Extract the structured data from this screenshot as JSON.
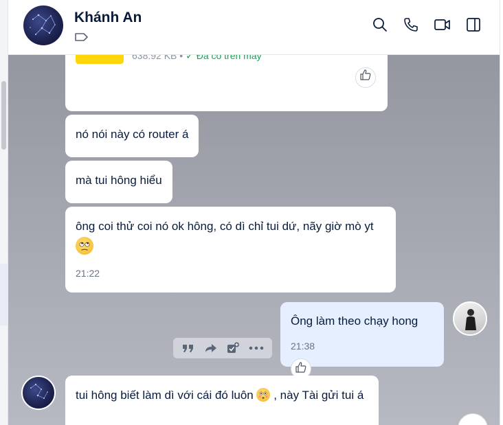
{
  "header": {
    "contact_name": "Khánh An",
    "icons": [
      "search-icon",
      "phone-icon",
      "video-call-icon",
      "sidebar-toggle-icon"
    ]
  },
  "file_message": {
    "size": "638.92 KB",
    "separator": "•",
    "status": "Đã có trên máy"
  },
  "messages": [
    {
      "side": "left",
      "text": "nó nói này có router á"
    },
    {
      "side": "left",
      "text": "mà tui hông hiểu"
    },
    {
      "side": "left",
      "text": "ông coi thử coi nó ok hông, có dì chỉ tui dứ, nãy giờ mò yt",
      "emoji": "rolling-eyes-emoji",
      "time": "21:22"
    },
    {
      "side": "right",
      "text": "Ông làm theo chạy hong",
      "time": "21:38"
    },
    {
      "side": "left",
      "text_a": "tui hông biết làm dì với cái đó luôn",
      "emoji": "flushed-emoji",
      "text_b": ", này Tài gửi tui á"
    }
  ],
  "colors": {
    "chat_background": "#a1a3ac",
    "bubble_incoming": "#ffffff",
    "bubble_outgoing": "#e5efff",
    "text_primary": "#081b3a",
    "status_ok": "#18a058"
  }
}
